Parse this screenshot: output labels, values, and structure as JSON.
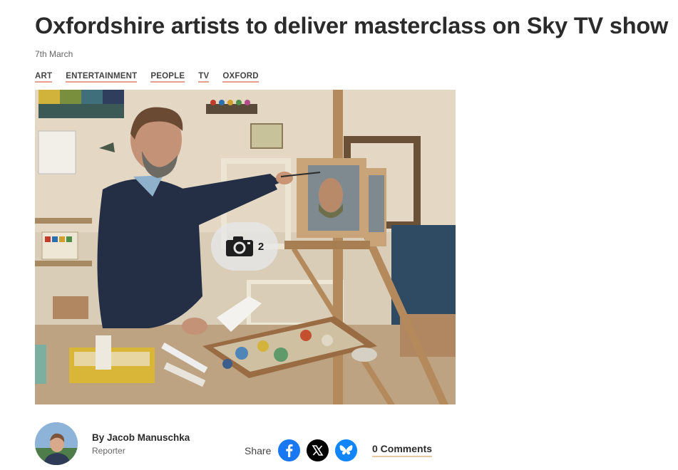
{
  "article": {
    "headline": "Oxfordshire artists to deliver masterclass on Sky TV show",
    "date": "7th March"
  },
  "tags": [
    "ART",
    "ENTERTAINMENT",
    "PEOPLE",
    "TV",
    "OXFORD"
  ],
  "hero": {
    "gallery_count": "2",
    "icon": "camera-icon"
  },
  "author": {
    "name": "By Jacob Manuschka",
    "role": "Reporter"
  },
  "share": {
    "label": "Share",
    "networks": [
      {
        "name": "facebook-icon",
        "color": "#1877f2"
      },
      {
        "name": "x-icon",
        "color": "#000000"
      },
      {
        "name": "bluesky-icon",
        "color": "#1185fe"
      }
    ]
  },
  "comments": {
    "label": "0 Comments"
  },
  "colors": {
    "headline": "#2b2b2b",
    "tag_underline": "#e8a08c"
  }
}
